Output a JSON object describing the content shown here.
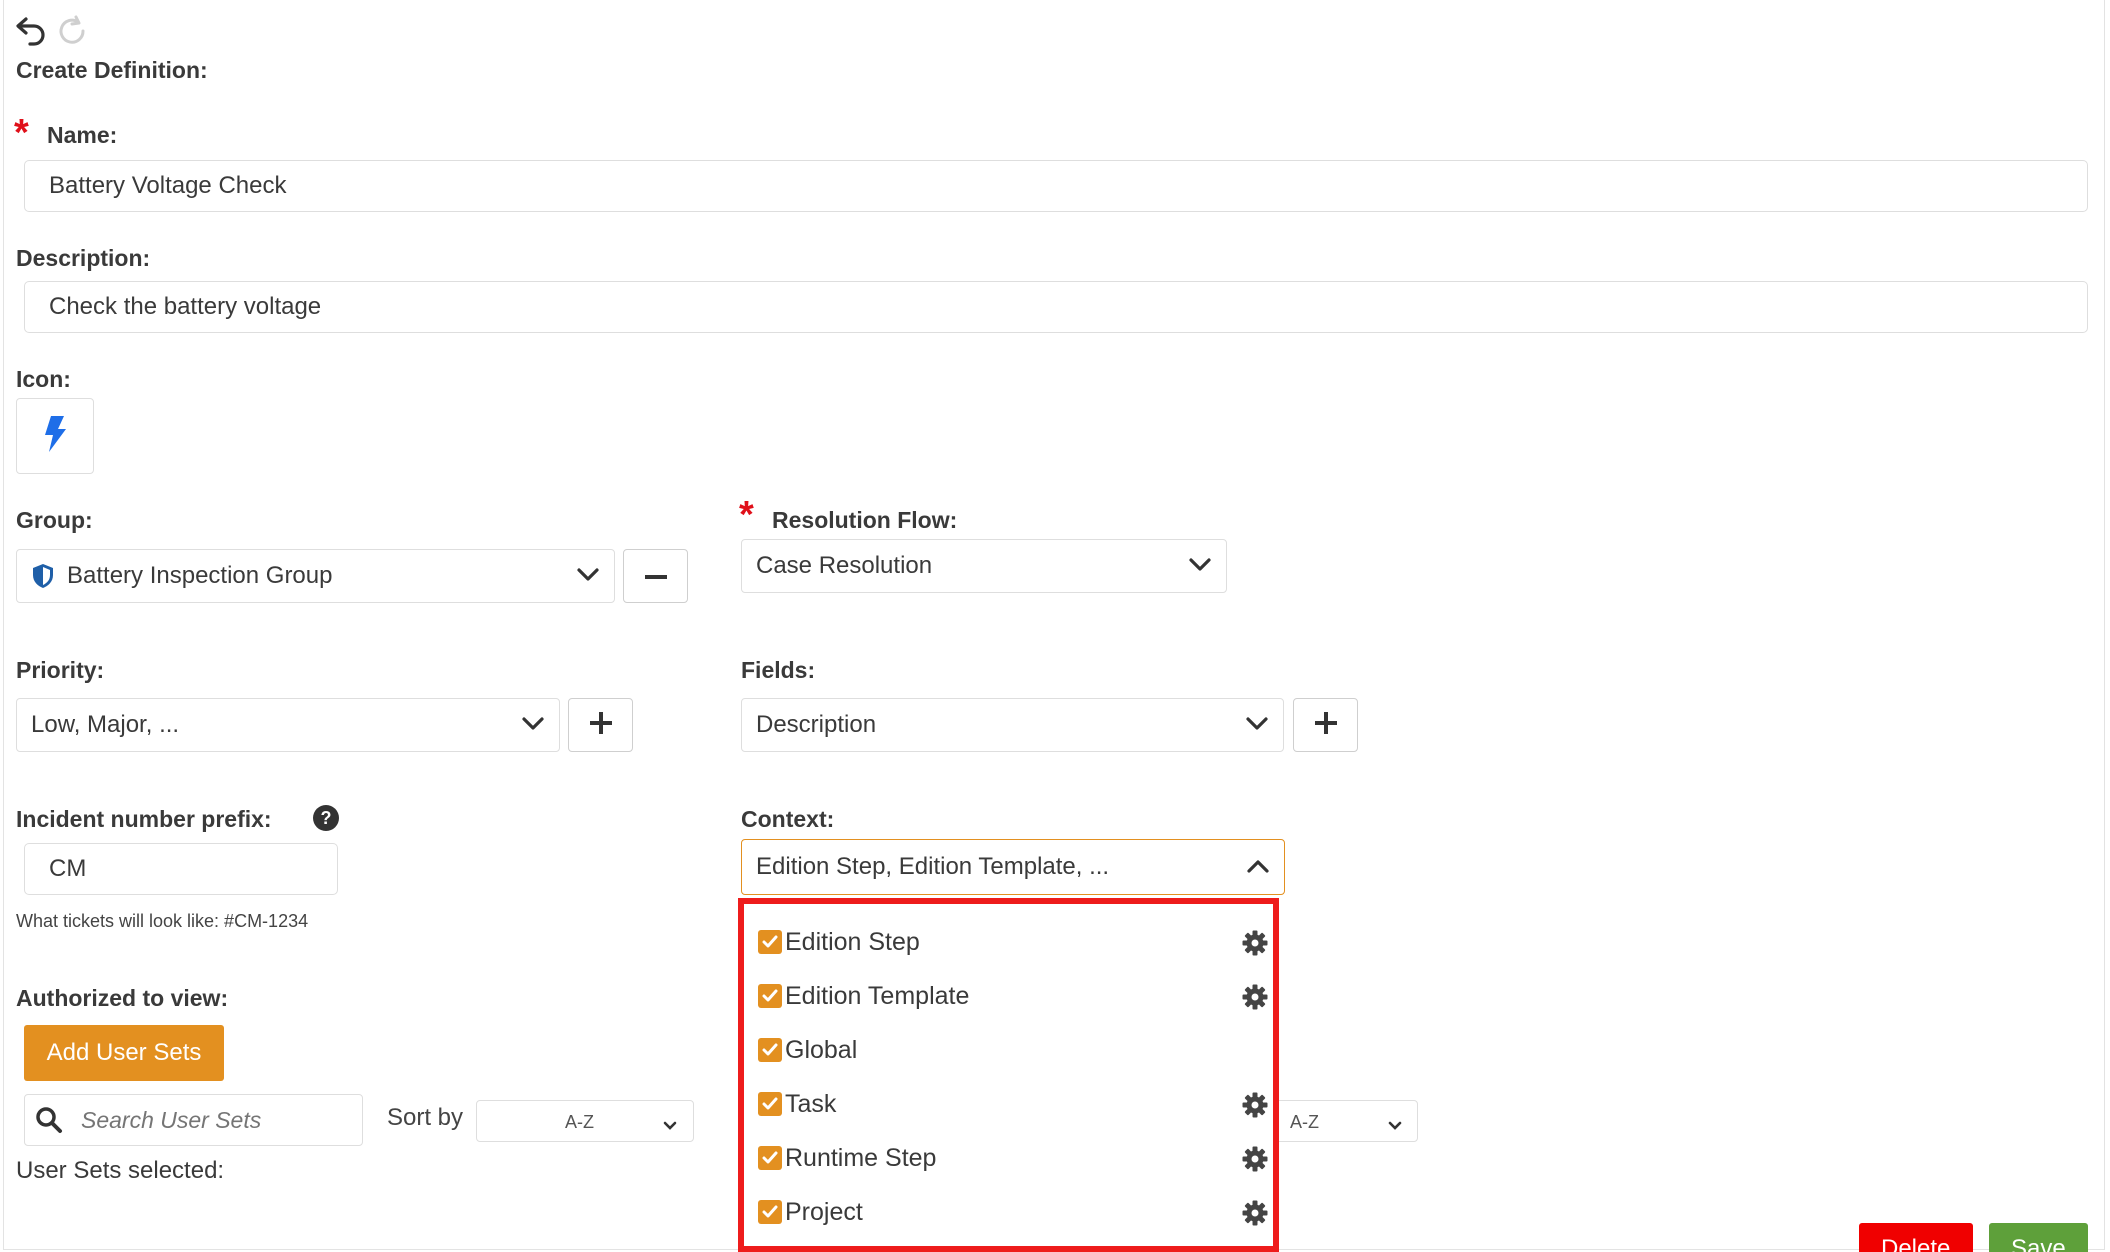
{
  "toolbar": {
    "undo_icon": "undo-icon",
    "redo_icon": "redo-icon"
  },
  "form": {
    "heading": "Create Definition:",
    "name_label": "Name:",
    "name_value": "Battery Voltage Check",
    "description_label": "Description:",
    "description_value": "Check the battery voltage",
    "icon_label": "Icon:",
    "icon_name": "lightning-bolt-icon",
    "group_label": "Group:",
    "group_value": "Battery Inspection Group",
    "resolution_label": "Resolution Flow:",
    "resolution_value": "Case Resolution",
    "priority_label": "Priority:",
    "priority_value": "Low, Major, ...",
    "fields_label": "Fields:",
    "fields_value": "Description",
    "prefix_label": "Incident number prefix:",
    "prefix_value": "CM",
    "prefix_hint": "What tickets will look like: #CM-1234",
    "context_label": "Context:",
    "context_value": "Edition Step, Edition Template, ...",
    "authorized_label": "Authorized to view:",
    "add_user_sets_label": "Add User Sets",
    "search_placeholder": "Search User Sets",
    "sort_by_label": "Sort by",
    "sort_value_left": "A-Z",
    "sort_value_right": "A-Z",
    "user_sets_selected_label": "User Sets selected:"
  },
  "context_options": [
    {
      "label": "Edition Step",
      "checked": true,
      "has_settings": true
    },
    {
      "label": "Edition Template",
      "checked": true,
      "has_settings": true
    },
    {
      "label": "Global",
      "checked": true,
      "has_settings": false
    },
    {
      "label": "Task",
      "checked": true,
      "has_settings": true
    },
    {
      "label": "Runtime Step",
      "checked": true,
      "has_settings": true
    },
    {
      "label": "Project",
      "checked": true,
      "has_settings": true
    }
  ],
  "actions": {
    "delete_label": "Delete",
    "save_label": "Save"
  },
  "colors": {
    "accent": "#e39020",
    "required": "#e0101a",
    "delete": "#f00000",
    "save": "#5ea03a",
    "highlight": "#ee1c1c",
    "icon_blue": "#1e6ee8"
  }
}
